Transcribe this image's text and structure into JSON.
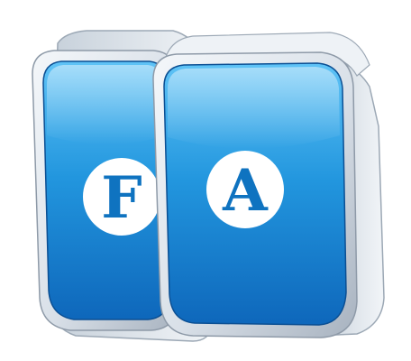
{
  "logo": {
    "letters": [
      "F",
      "A"
    ],
    "colors": {
      "tile_blue_light": "#5fc3f6",
      "tile_blue_mid": "#2296de",
      "tile_blue_dark": "#0e67bb",
      "frame_light": "#f4f7fa",
      "frame_shadow": "#a7b2bf",
      "badge_white": "#ffffff",
      "letter_blue": "#0f73c0"
    }
  }
}
